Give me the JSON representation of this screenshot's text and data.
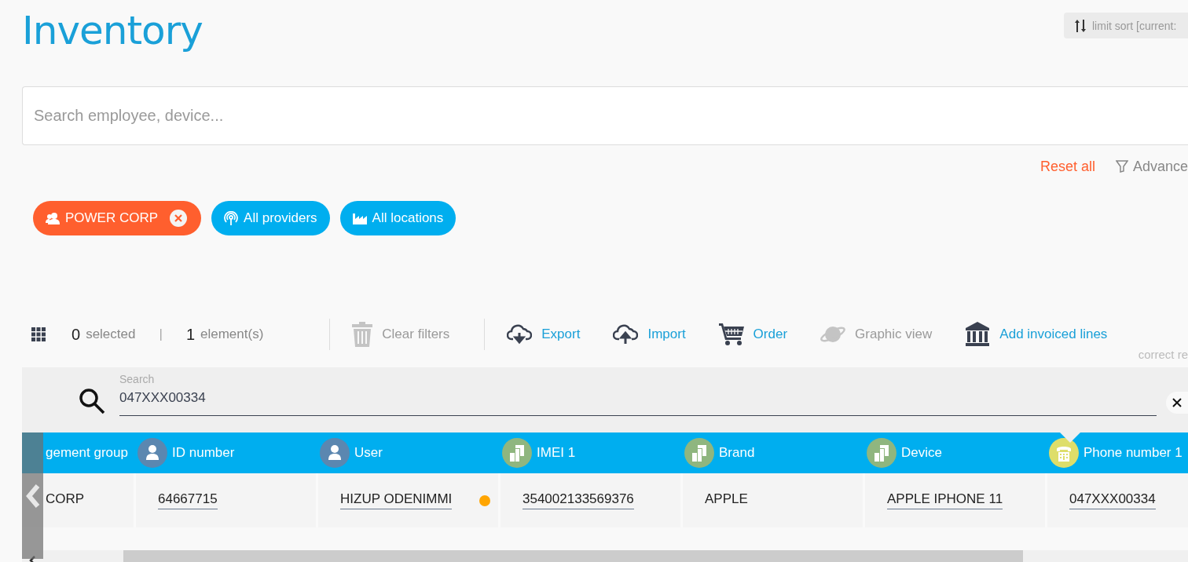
{
  "title": "Inventory",
  "sort_button": {
    "label": "limit sort [current:"
  },
  "search": {
    "placeholder": "Search employee, device..."
  },
  "filter_actions": {
    "reset": "Reset all",
    "advanced": "Advance"
  },
  "chips": [
    {
      "kind": "company",
      "label": "POWER CORP",
      "removable": true
    },
    {
      "kind": "provider",
      "label": "All providers",
      "removable": false
    },
    {
      "kind": "location",
      "label": "All locations",
      "removable": false
    }
  ],
  "toolbar": {
    "selected_count": "0",
    "selected_label": "selected",
    "separator": "|",
    "element_count": "1",
    "element_label": "element(s)",
    "actions": [
      {
        "kind": "trash",
        "label": "Clear filters",
        "disabled": true
      },
      {
        "kind": "export",
        "label": "Export",
        "disabled": false
      },
      {
        "kind": "import",
        "label": "Import",
        "disabled": false
      },
      {
        "kind": "cart",
        "label": "Order",
        "disabled": false
      },
      {
        "kind": "planet",
        "label": "Graphic view",
        "disabled": true
      },
      {
        "kind": "bank",
        "label": "Add invoiced lines",
        "disabled": false
      }
    ],
    "hint": "correct re"
  },
  "table": {
    "search": {
      "label": "Search",
      "value": "047XXX00334"
    },
    "columns": [
      {
        "label": "gement group",
        "kind": "plain",
        "sorted": false
      },
      {
        "label": "ID number",
        "kind": "person",
        "sorted": false
      },
      {
        "label": "User",
        "kind": "person",
        "sorted": false
      },
      {
        "label": "IMEI 1",
        "kind": "device",
        "sorted": false
      },
      {
        "label": "Brand",
        "kind": "device",
        "sorted": false
      },
      {
        "label": "Device",
        "kind": "device",
        "sorted": false
      },
      {
        "label": "Phone number 1",
        "kind": "phone",
        "sorted": true
      }
    ],
    "rows": [
      {
        "cells": [
          {
            "text": "CORP",
            "kind": "plain"
          },
          {
            "text": "64667715",
            "kind": "link"
          },
          {
            "text": "HIZUP ODENIMMI",
            "kind": "link",
            "color": "#ffa500"
          },
          {
            "text": "354002133569376",
            "kind": "link"
          },
          {
            "text": "APPLE",
            "kind": "plain"
          },
          {
            "text": "APPLE IPHONE 11",
            "kind": "link"
          },
          {
            "text": "047XXX00334",
            "kind": "link"
          }
        ]
      }
    ]
  }
}
